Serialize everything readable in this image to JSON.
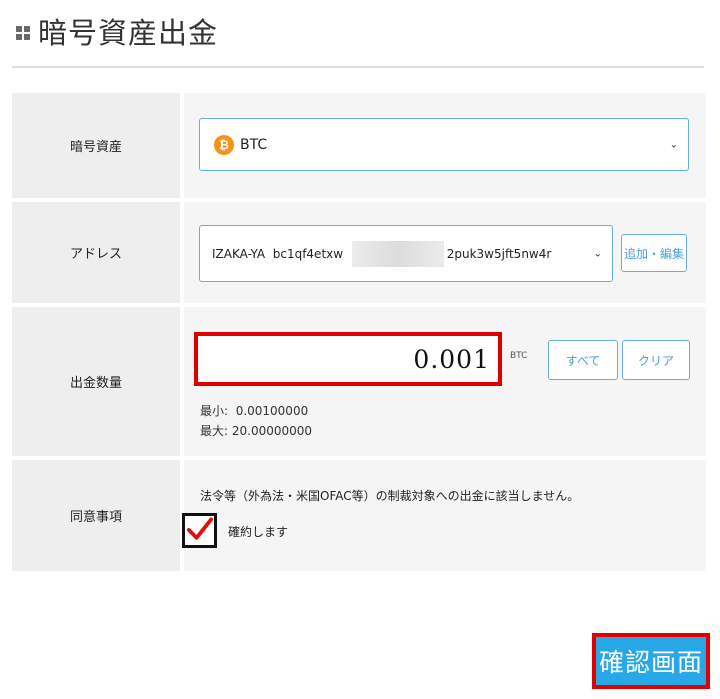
{
  "page": {
    "title": "暗号資産出金"
  },
  "form": {
    "asset": {
      "label": "暗号資産",
      "icon": "bitcoin-icon",
      "icon_glyph": "₿",
      "value": "BTC"
    },
    "address": {
      "label": "アドレス",
      "name": "IZAKA-YA",
      "value_start": "bc1qf4etxw",
      "value_end": "2puk3w5jft5nw4r",
      "edit_button": "追加・編集"
    },
    "amount": {
      "label": "出金数量",
      "value": "0.001",
      "unit": "BTC",
      "all_button": "すべて",
      "clear_button": "クリア",
      "min_label": "最小:",
      "min_value": "0.00100000",
      "max_label": "最大:",
      "max_value": "20.00000000"
    },
    "consent": {
      "label": "同意事項",
      "statement": "法令等（外為法・米国OFAC等）の制裁対象への出金に該当しません。",
      "checkbox_label": "確約します",
      "checked": true
    }
  },
  "confirm_button": "確認画面",
  "colors": {
    "accent": "#29a8e8",
    "highlight": "#e00000",
    "bitcoin": "#f7931a",
    "check": "#e01010"
  }
}
